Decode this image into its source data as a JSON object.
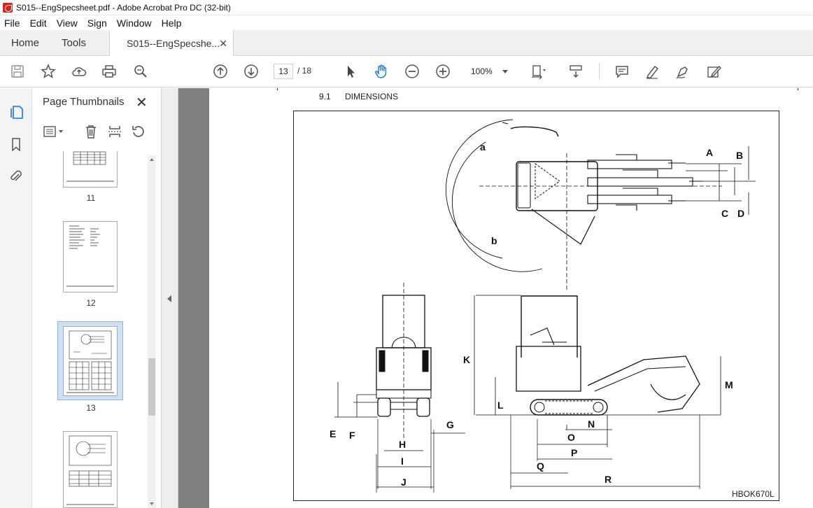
{
  "window": {
    "title": "S015--EngSpecsheet.pdf - Adobe Acrobat Pro DC (32-bit)"
  },
  "menu": [
    "File",
    "Edit",
    "View",
    "Sign",
    "Window",
    "Help"
  ],
  "tabs": {
    "home": "Home",
    "tools": "Tools",
    "document": "S015--EngSpecshe..."
  },
  "toolbar": {
    "page_current": "13",
    "page_total": "/ 18",
    "zoom": "100%",
    "icons": [
      "save-icon",
      "bookmark-star-icon",
      "upload-icon",
      "print-icon",
      "find-icon",
      "page-up-icon",
      "page-down-icon",
      "select-arrow-icon",
      "hand-icon",
      "zoom-out-icon",
      "zoom-in-icon",
      "fit-page-icon",
      "scroll-mode-icon",
      "comment-icon",
      "highlight-icon",
      "sign-icon",
      "fill-sign-icon"
    ]
  },
  "panel": {
    "title": "Page Thumbnails",
    "thumbnails": [
      {
        "label": "11"
      },
      {
        "label": "12"
      },
      {
        "label": "13",
        "selected": true
      },
      {
        "label": ""
      }
    ]
  },
  "document": {
    "section_number": "9.1",
    "section_title": "DIMENSIONS",
    "figure_code": "HBOK670L",
    "dimension_labels": [
      "a",
      "b",
      "A",
      "B",
      "C",
      "D",
      "E",
      "F",
      "G",
      "H",
      "I",
      "J",
      "K",
      "L",
      "M",
      "N",
      "O",
      "P",
      "Q",
      "R"
    ]
  },
  "colors": {
    "accent": "#1473e6",
    "selected_thumb": "#cde1f7",
    "doc_bg": "#7f7f7f"
  }
}
